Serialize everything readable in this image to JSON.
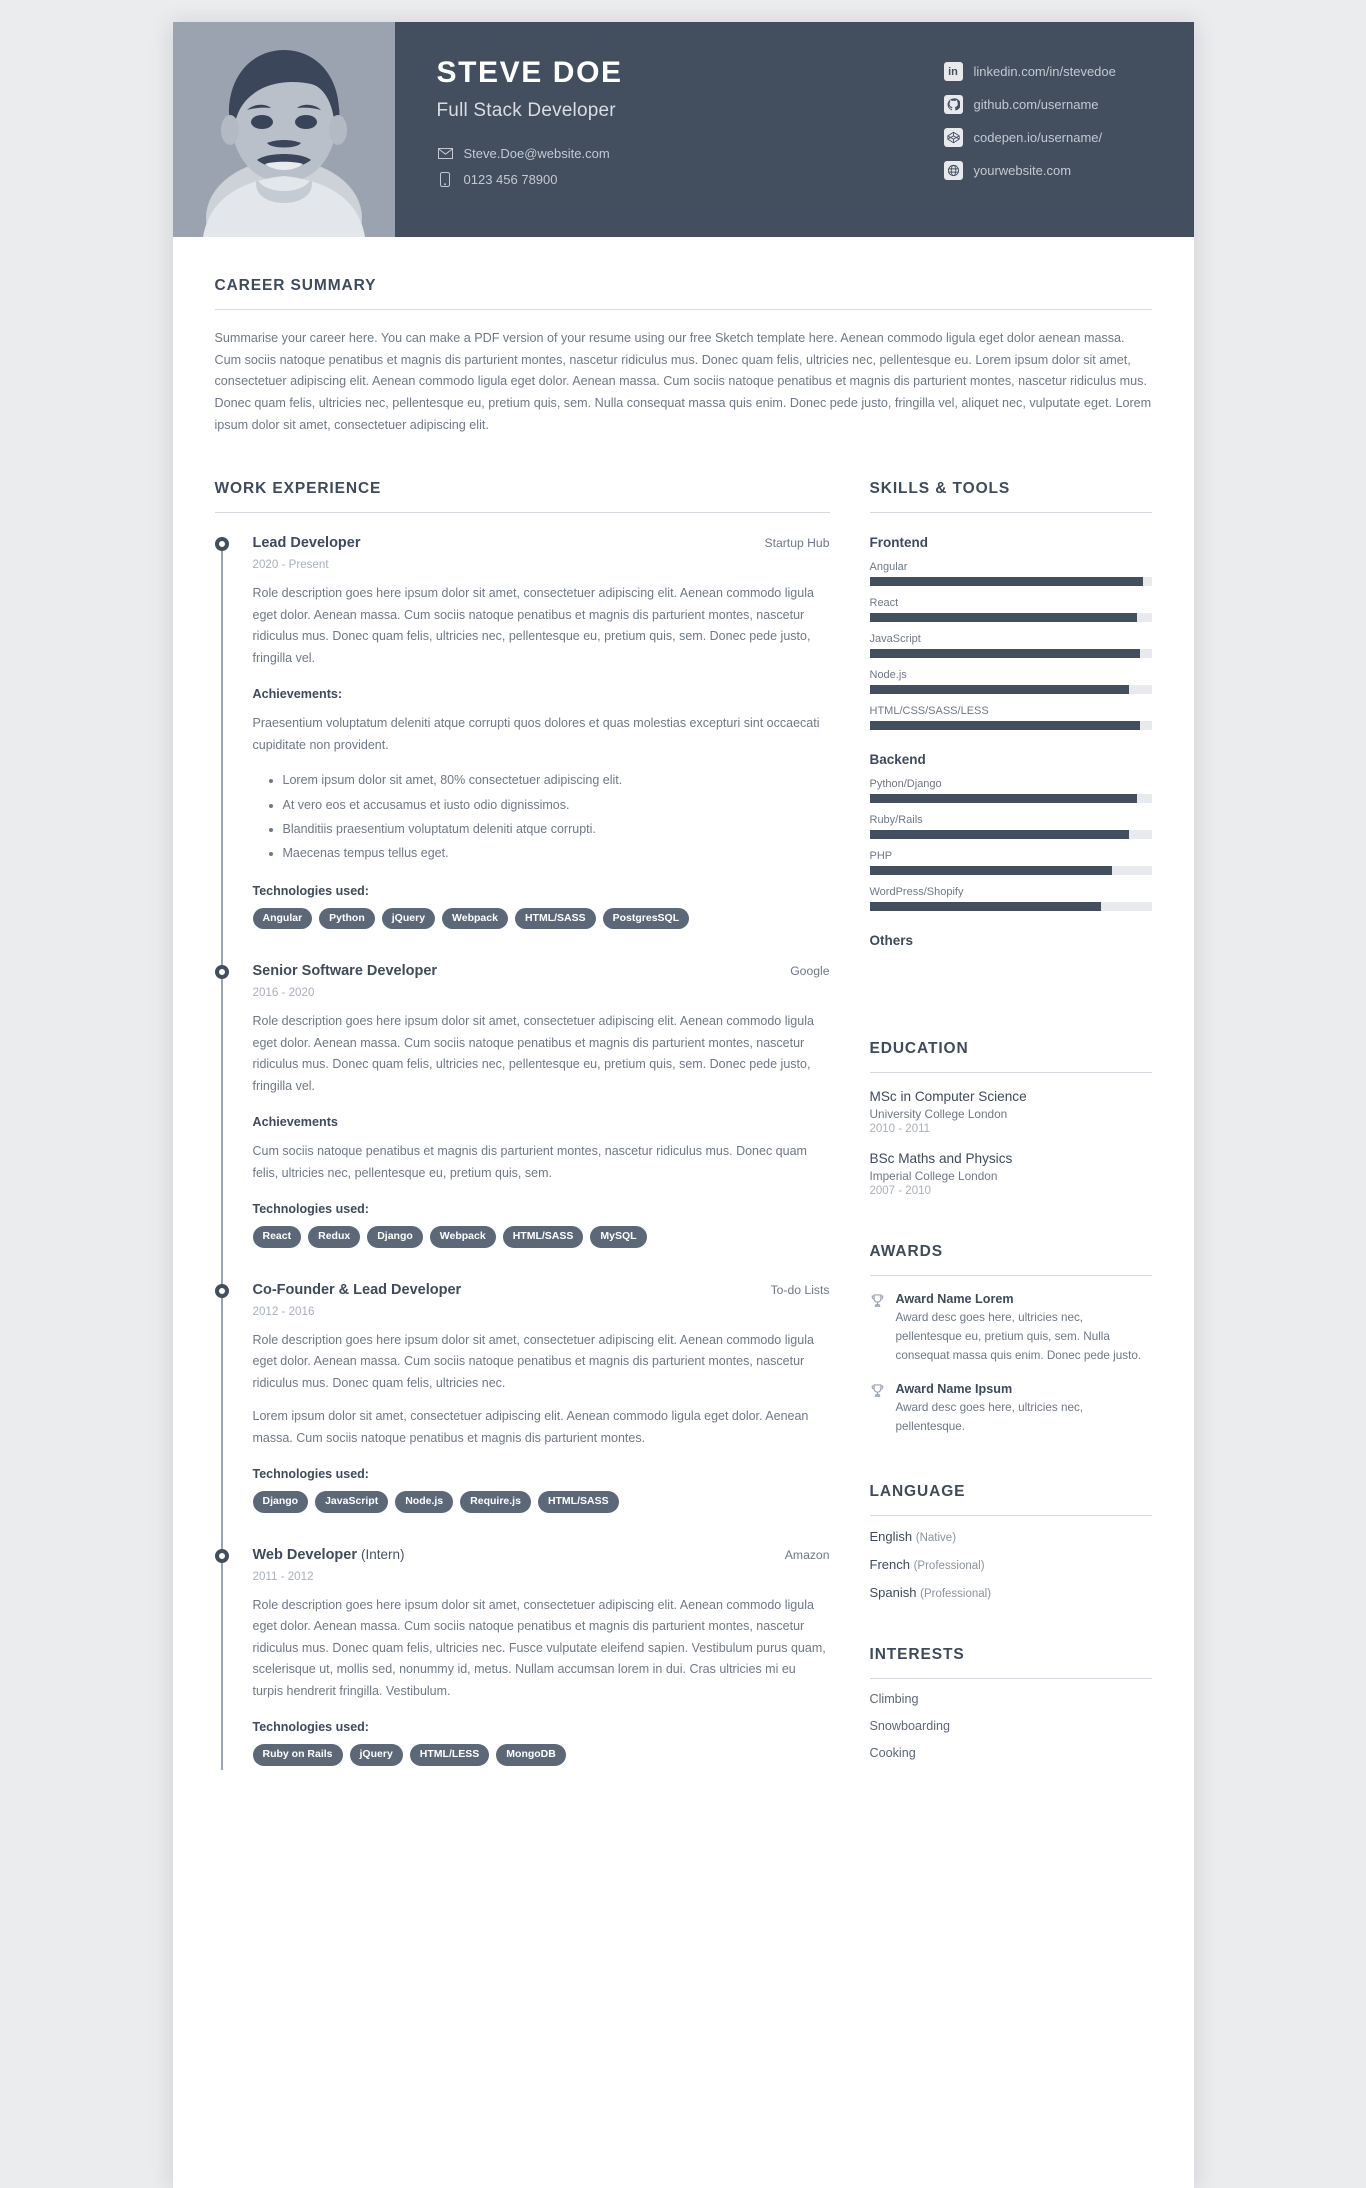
{
  "colors": {
    "header_bg": "#434e5e",
    "accent": "#434e5e",
    "tag_bg": "#5c6878",
    "page_bg": "#ebecee",
    "muted_text": "#6f7884"
  },
  "header": {
    "name": "STEVE DOE",
    "title": "Full Stack Developer",
    "contacts": [
      {
        "icon": "envelope-icon",
        "text": "Steve.Doe@website.com"
      },
      {
        "icon": "phone-icon",
        "text": "0123 456 78900"
      }
    ],
    "links": [
      {
        "icon": "linkedin-icon",
        "text": "linkedin.com/in/stevedoe"
      },
      {
        "icon": "github-icon",
        "text": "github.com/username"
      },
      {
        "icon": "codepen-icon",
        "text": "codepen.io/username/"
      },
      {
        "icon": "globe-icon",
        "text": "yourwebsite.com"
      }
    ]
  },
  "summary": {
    "heading": "CAREER SUMMARY",
    "text": "Summarise your career here. You can make a PDF version of your resume using our free Sketch template here. Aenean commodo ligula eget dolor aenean massa. Cum sociis natoque penatibus et magnis dis parturient montes, nascetur ridiculus mus. Donec quam felis, ultricies nec, pellentesque eu. Lorem ipsum dolor sit amet, consectetuer adipiscing elit. Aenean commodo ligula eget dolor. Aenean massa. Cum sociis natoque penatibus et magnis dis parturient montes, nascetur ridiculus mus. Donec quam felis, ultricies nec, pellentesque eu, pretium quis, sem. Nulla consequat massa quis enim. Donec pede justo, fringilla vel, aliquet nec, vulputate eget. Lorem ipsum dolor sit amet, consectetuer adipiscing elit."
  },
  "work": {
    "heading": "WORK EXPERIENCE",
    "tech_label": "Technologies used:",
    "jobs": [
      {
        "title": "Lead Developer",
        "title_suffix": "",
        "company": "Startup Hub",
        "dates": "2020 - Present",
        "desc": "Role description goes here ipsum dolor sit amet, consectetuer adipiscing elit. Aenean commodo ligula eget dolor. Aenean massa. Cum sociis natoque penatibus et magnis dis parturient montes, nascetur ridiculus mus. Donec quam felis, ultricies nec, pellentesque eu, pretium quis, sem. Donec pede justo, fringilla vel.",
        "ach_label": "Achievements:",
        "ach_text": "Praesentium voluptatum deleniti atque corrupti quos dolores et quas molestias excepturi sint occaecati cupiditate non provident.",
        "desc2": "",
        "bullets": [
          "Lorem ipsum dolor sit amet, 80% consectetuer adipiscing elit.",
          "At vero eos et accusamus et iusto odio dignissimos.",
          "Blanditiis praesentium voluptatum deleniti atque corrupti.",
          "Maecenas tempus tellus eget."
        ],
        "tags": [
          "Angular",
          "Python",
          "jQuery",
          "Webpack",
          "HTML/SASS",
          "PostgresSQL"
        ]
      },
      {
        "title": "Senior Software Developer",
        "title_suffix": "",
        "company": "Google",
        "dates": "2016 - 2020",
        "desc": "Role description goes here ipsum dolor sit amet, consectetuer adipiscing elit. Aenean commodo ligula eget dolor. Aenean massa. Cum sociis natoque penatibus et magnis dis parturient montes, nascetur ridiculus mus. Donec quam felis, ultricies nec, pellentesque eu, pretium quis, sem. Donec pede justo, fringilla vel.",
        "ach_label": "Achievements",
        "ach_text": "Cum sociis natoque penatibus et magnis dis parturient montes, nascetur ridiculus mus. Donec quam felis, ultricies nec, pellentesque eu, pretium quis, sem.",
        "desc2": "",
        "bullets": [],
        "tags": [
          "React",
          "Redux",
          "Django",
          "Webpack",
          "HTML/SASS",
          "MySQL"
        ]
      },
      {
        "title": "Co-Founder & Lead Developer",
        "title_suffix": "",
        "company": "To-do Lists",
        "dates": "2012 - 2016",
        "desc": "Role description goes here ipsum dolor sit amet, consectetuer adipiscing elit. Aenean commodo ligula eget dolor. Aenean massa. Cum sociis natoque penatibus et magnis dis parturient montes, nascetur ridiculus mus. Donec quam felis, ultricies nec.",
        "ach_label": "",
        "ach_text": "",
        "desc2": "Lorem ipsum dolor sit amet, consectetuer adipiscing elit. Aenean commodo ligula eget dolor. Aenean massa. Cum sociis natoque penatibus et magnis dis parturient montes.",
        "bullets": [],
        "tags": [
          "Django",
          "JavaScript",
          "Node.js",
          "Require.js",
          "HTML/SASS"
        ]
      },
      {
        "title": "Web Developer",
        "title_suffix": "(Intern)",
        "company": "Amazon",
        "dates": "2011 - 2012",
        "desc": "Role description goes here ipsum dolor sit amet, consectetuer adipiscing elit. Aenean commodo ligula eget dolor. Aenean massa. Cum sociis natoque penatibus et magnis dis parturient montes, nascetur ridiculus mus. Donec quam felis, ultricies nec. Fusce vulputate eleifend sapien. Vestibulum purus quam, scelerisque ut, mollis sed, nonummy id, metus. Nullam accumsan lorem in dui. Cras ultricies mi eu turpis hendrerit fringilla. Vestibulum.",
        "ach_label": "",
        "ach_text": "",
        "desc2": "",
        "bullets": [],
        "tags": [
          "Ruby on Rails",
          "jQuery",
          "HTML/LESS",
          "MongoDB"
        ]
      }
    ]
  },
  "skills": {
    "heading": "SKILLS & TOOLS",
    "groups": [
      {
        "name": "Frontend",
        "items": [
          {
            "name": "Angular",
            "level": 97
          },
          {
            "name": "React",
            "level": 95
          },
          {
            "name": "JavaScript",
            "level": 96
          },
          {
            "name": "Node.js",
            "level": 92
          },
          {
            "name": "HTML/CSS/SASS/LESS",
            "level": 96
          }
        ]
      },
      {
        "name": "Backend",
        "items": [
          {
            "name": "Python/Django",
            "level": 95
          },
          {
            "name": "Ruby/Rails",
            "level": 92
          },
          {
            "name": "PHP",
            "level": 86
          },
          {
            "name": "WordPress/Shopify",
            "level": 82
          }
        ]
      },
      {
        "name": "Others",
        "items": []
      }
    ]
  },
  "education": {
    "heading": "EDUCATION",
    "items": [
      {
        "degree": "MSc in Computer Science",
        "school": "University College London",
        "years": "2010 - 2011"
      },
      {
        "degree": "BSc Maths and Physics",
        "school": "Imperial College London",
        "years": "2007 - 2010"
      }
    ]
  },
  "awards": {
    "heading": "AWARDS",
    "items": [
      {
        "name": "Award Name Lorem",
        "desc": "Award desc goes here, ultricies nec, pellentesque eu, pretium quis, sem. Nulla consequat massa quis enim. Donec pede justo."
      },
      {
        "name": "Award Name Ipsum",
        "desc": "Award desc goes here, ultricies nec, pellentesque."
      }
    ]
  },
  "language": {
    "heading": "LANGUAGE",
    "items": [
      {
        "name": "English",
        "level": "(Native)"
      },
      {
        "name": "French",
        "level": "(Professional)"
      },
      {
        "name": "Spanish",
        "level": "(Professional)"
      }
    ]
  },
  "interests": {
    "heading": "INTERESTS",
    "items": [
      "Climbing",
      "Snowboarding",
      "Cooking"
    ]
  }
}
